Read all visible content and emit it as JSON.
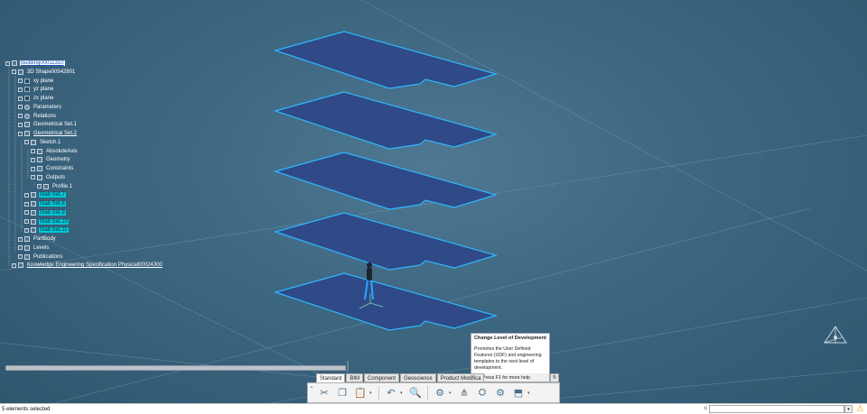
{
  "tree": {
    "items": [
      {
        "label": "Building00011310",
        "style": "root",
        "icon": "building-icon",
        "depth": 0
      },
      {
        "label": "3D Shape00542801",
        "style": "normal",
        "icon": "part-icon",
        "depth": 1
      },
      {
        "label": "xy plane",
        "style": "normal",
        "icon": "plane-icon",
        "depth": 2
      },
      {
        "label": "yz plane",
        "style": "normal",
        "icon": "plane-icon",
        "depth": 2
      },
      {
        "label": "zx plane",
        "style": "normal",
        "icon": "plane-icon",
        "depth": 2
      },
      {
        "label": "Parameters",
        "style": "normal",
        "icon": "parameters-icon",
        "depth": 2
      },
      {
        "label": "Relations",
        "style": "normal",
        "icon": "relations-icon",
        "depth": 2
      },
      {
        "label": "Geometrical Set.1",
        "style": "normal",
        "icon": "geometrical-set-icon",
        "depth": 2
      },
      {
        "label": "Geometrical Set.2",
        "style": "link",
        "icon": "geometrical-set-icon",
        "depth": 2
      },
      {
        "label": "Sketch.1",
        "style": "normal",
        "icon": "sketch-icon",
        "depth": 3
      },
      {
        "label": "AbsoluteAxis",
        "style": "normal",
        "icon": "axis-icon",
        "depth": 4
      },
      {
        "label": "Geometry",
        "style": "normal",
        "icon": "geometry-icon",
        "depth": 4
      },
      {
        "label": "Constraints",
        "style": "normal",
        "icon": "constraints-icon",
        "depth": 4
      },
      {
        "label": "Outputs",
        "style": "normal",
        "icon": "outputs-icon",
        "depth": 4
      },
      {
        "label": "Profile.1",
        "style": "normal",
        "icon": "profile-icon",
        "depth": 5
      },
      {
        "label": "Slab Set.7",
        "style": "selected",
        "icon": "slab-icon",
        "depth": 3
      },
      {
        "label": "Slab Set.8",
        "style": "selected",
        "icon": "slab-icon",
        "depth": 3
      },
      {
        "label": "Slab Set.9",
        "style": "selected",
        "icon": "slab-icon",
        "depth": 3
      },
      {
        "label": "Slab Set.10",
        "style": "selected",
        "icon": "slab-icon",
        "depth": 3
      },
      {
        "label": "Slab Set.11",
        "style": "selected",
        "icon": "slab-icon",
        "depth": 3
      },
      {
        "label": "PartBody",
        "style": "normal",
        "icon": "partbody-icon",
        "depth": 2
      },
      {
        "label": "Levels",
        "style": "normal",
        "icon": "levels-icon",
        "depth": 2
      },
      {
        "label": "Publications",
        "style": "normal",
        "icon": "publications-icon",
        "depth": 2
      },
      {
        "label": "Knowledge Engineering Specification Physical00024300",
        "style": "link",
        "icon": "knowledge-icon",
        "depth": 1
      }
    ]
  },
  "tooltip": {
    "title": "Change Level of Development",
    "body": "Promotes the User Defined Features (UDF) and engineering templates to the next level of development.",
    "help": "Press F1 for more help"
  },
  "tabs": [
    "Standard",
    "BIM",
    "Component",
    "Geoscience",
    "Product Modifica"
  ],
  "tab_extra": "h",
  "toolbar": {
    "buttons": [
      {
        "name": "cut-icon",
        "glyph": "✂"
      },
      {
        "name": "copy-icon",
        "glyph": "❐"
      },
      {
        "name": "paste-icon",
        "glyph": "📋"
      },
      {
        "name": "undo-icon",
        "glyph": "↶"
      },
      {
        "name": "zoom-icon",
        "glyph": "🔍"
      },
      {
        "name": "update-icon",
        "glyph": "⚙"
      },
      {
        "name": "knowledge-tree-icon",
        "glyph": "⋔"
      },
      {
        "name": "change-level-icon",
        "glyph": "⛭"
      },
      {
        "name": "template-gear-icon",
        "glyph": "⚙"
      },
      {
        "name": "publish-icon",
        "glyph": "⬒"
      }
    ]
  },
  "status": {
    "text": "5 elements selected",
    "cmd_label": "c",
    "cmd_placeholder": ""
  },
  "colors": {
    "slab_fill": "#2f4a86",
    "slab_edge": "#2fb7ff",
    "selection": "#00c8d6"
  }
}
